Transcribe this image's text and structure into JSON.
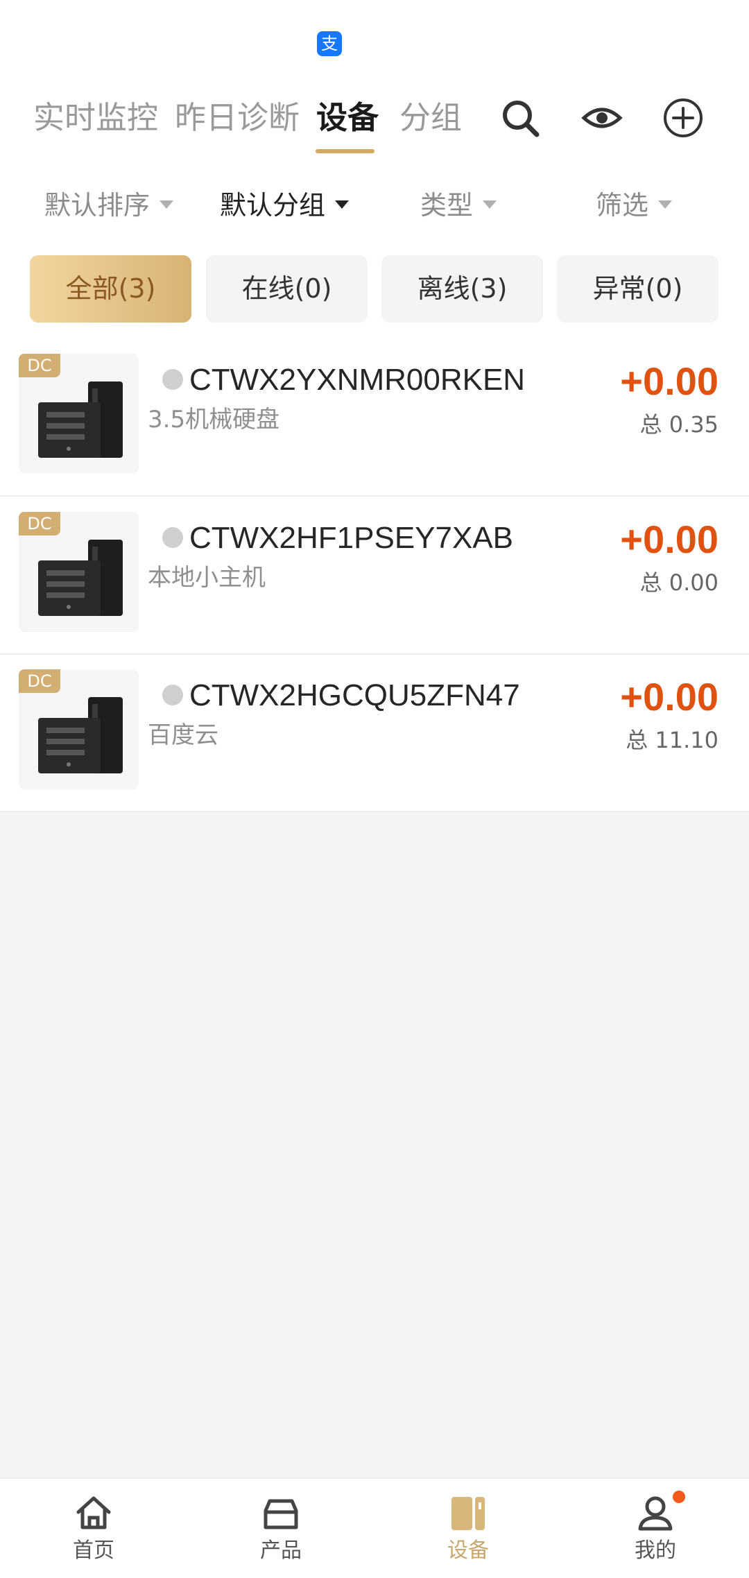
{
  "header": {
    "logo_glyph": "支",
    "tabs": [
      {
        "label": "实时监控"
      },
      {
        "label": "昨日诊断"
      },
      {
        "label": "设备"
      },
      {
        "label": "分组"
      }
    ],
    "icons": [
      "search-icon",
      "eye-icon",
      "add-circle-icon"
    ]
  },
  "sort_bar": {
    "items": [
      {
        "label": "默认排序"
      },
      {
        "label": "默认分组"
      },
      {
        "label": "类型"
      },
      {
        "label": "筛选"
      }
    ]
  },
  "chips": [
    {
      "label": "全部(3)"
    },
    {
      "label": "在线(0)"
    },
    {
      "label": "离线(3)"
    },
    {
      "label": "异常(0)"
    }
  ],
  "devices": [
    {
      "badge": "DC",
      "name": "CTWX2YXNMR00RKEN",
      "subtitle": "3.5机械硬盘",
      "gain": "+0.00",
      "total": "总 0.35"
    },
    {
      "badge": "DC",
      "name": "CTWX2HF1PSEY7XAB",
      "subtitle": "本地小主机",
      "gain": "+0.00",
      "total": "总 0.00"
    },
    {
      "badge": "DC",
      "name": "CTWX2HGCQU5ZFN47",
      "subtitle": "百度云",
      "gain": "+0.00",
      "total": "总 11.10"
    }
  ],
  "bottom_nav": {
    "items": [
      {
        "label": "首页",
        "icon": "home-icon"
      },
      {
        "label": "产品",
        "icon": "box-icon"
      },
      {
        "label": "设备",
        "icon": "device-icon"
      },
      {
        "label": "我的",
        "icon": "profile-icon"
      }
    ]
  },
  "colors": {
    "accent": "#d4a862",
    "gain": "#e0520f",
    "notification_dot": "#f05a1a"
  }
}
